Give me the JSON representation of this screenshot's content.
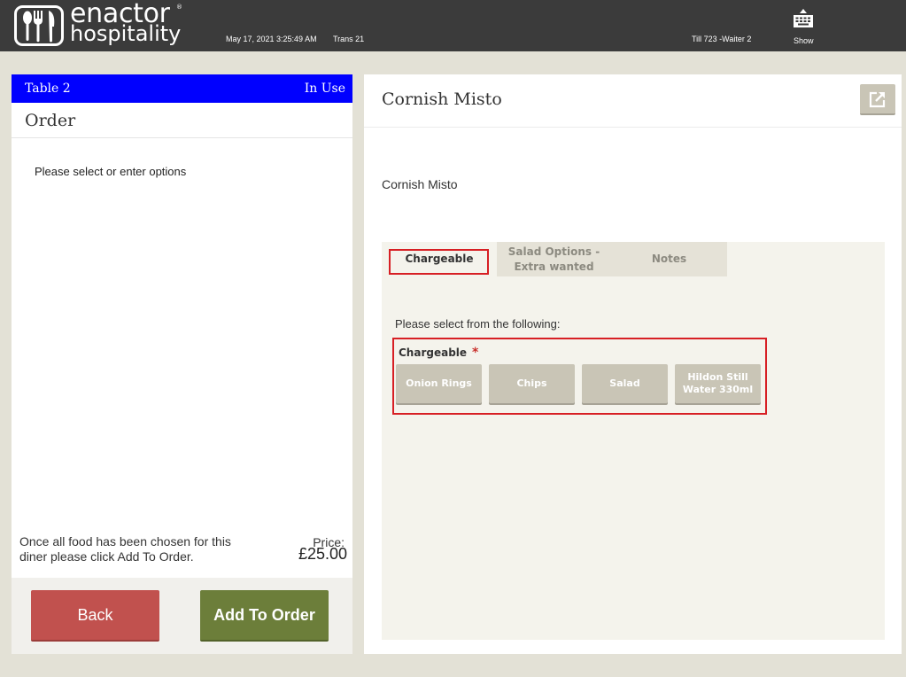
{
  "header": {
    "logo": {
      "word1": "enactor",
      "mark": "®",
      "word2": "hospitality",
      "icon": "cutlery-icon"
    },
    "datetime": "May 17, 2021 3:25:49 AM",
    "transaction": "Trans 21",
    "till": "Till 723 -Waiter 2",
    "keyboard": {
      "icon": "keyboard-icon",
      "label": "Show"
    }
  },
  "order_panel": {
    "table_label": "Table 2",
    "status": "In Use",
    "title": "Order",
    "prompt": "Please select or enter options",
    "note": "Once all food has been chosen for this diner please click Add To Order.",
    "price_label": "Price:",
    "price_value": "£25.00",
    "back_label": "Back",
    "add_label": "Add To Order"
  },
  "product_panel": {
    "title": "Cornish Misto",
    "popout_icon": "external-link-icon",
    "description": "Cornish Misto",
    "tabs": [
      {
        "label": "Chargeable",
        "selected": true
      },
      {
        "label": "Salad Options - Extra wanted",
        "selected": false
      },
      {
        "label": "Notes",
        "selected": false
      }
    ],
    "instruction": "Please select from the following:",
    "group_label": "Chargeable",
    "required_mark": "*",
    "options": [
      "Onion Rings",
      "Chips",
      "Salad",
      "Hildon Still Water 330ml"
    ]
  },
  "colors": {
    "topbar": "#3b3b3b",
    "background": "#e3e1d6",
    "table_header": "#0000ff",
    "back_button": "#c1514e",
    "add_button": "#6c7e3a",
    "option_button": "#c9c5b6",
    "highlight": "#d71f24"
  }
}
